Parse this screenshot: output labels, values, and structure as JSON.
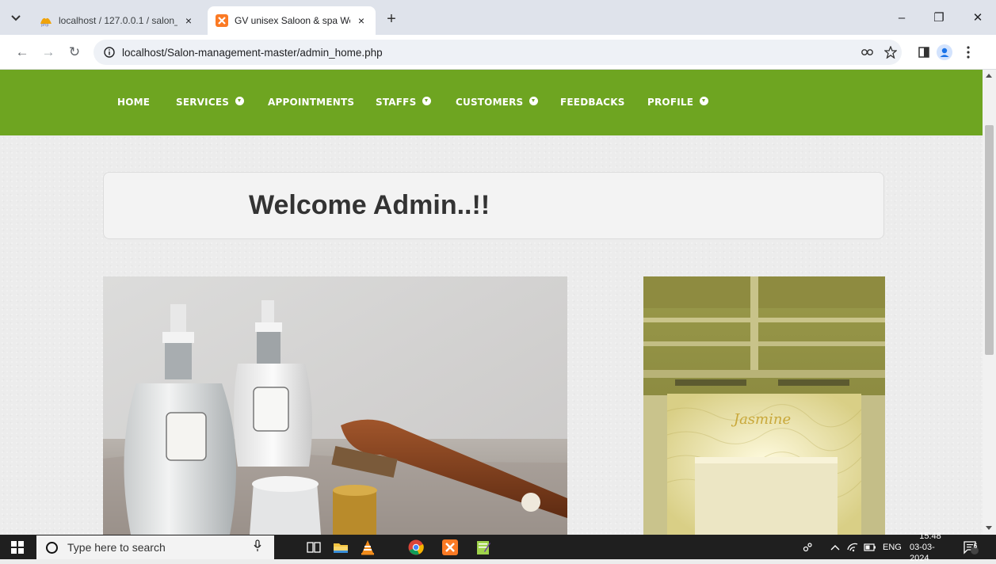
{
  "browser": {
    "tabs": [
      {
        "title": "localhost / 127.0.0.1 / salon_ma",
        "close": "×",
        "favicon": "phpmyadmin-icon"
      },
      {
        "title": "GV unisex Saloon & spa Websit",
        "close": "×",
        "favicon": "xampp-icon"
      }
    ],
    "new_tab": "+",
    "tab_search": "⌄",
    "window_controls": {
      "minimize": "–",
      "restore": "❐",
      "close": "✕"
    },
    "url": "localhost/Salon-management-master/admin_home.php",
    "nav": {
      "back": "←",
      "forward": "→",
      "reload": "↻"
    }
  },
  "site": {
    "accent_color": "#6ea521",
    "nav": [
      {
        "label": "HOME",
        "dropdown": false
      },
      {
        "label": "SERVICES",
        "dropdown": true
      },
      {
        "label": "APPOINTMENTS",
        "dropdown": false
      },
      {
        "label": "STAFFS",
        "dropdown": true
      },
      {
        "label": "CUSTOMERS",
        "dropdown": true
      },
      {
        "label": "FEEDBACKS",
        "dropdown": false
      },
      {
        "label": "PROFILE",
        "dropdown": true
      }
    ],
    "welcome": "Welcome Admin..!!"
  },
  "taskbar": {
    "search_placeholder": "Type here to search",
    "language": "ENG",
    "time": "15:48",
    "date": "03-03-2024",
    "notification_count": "6"
  }
}
